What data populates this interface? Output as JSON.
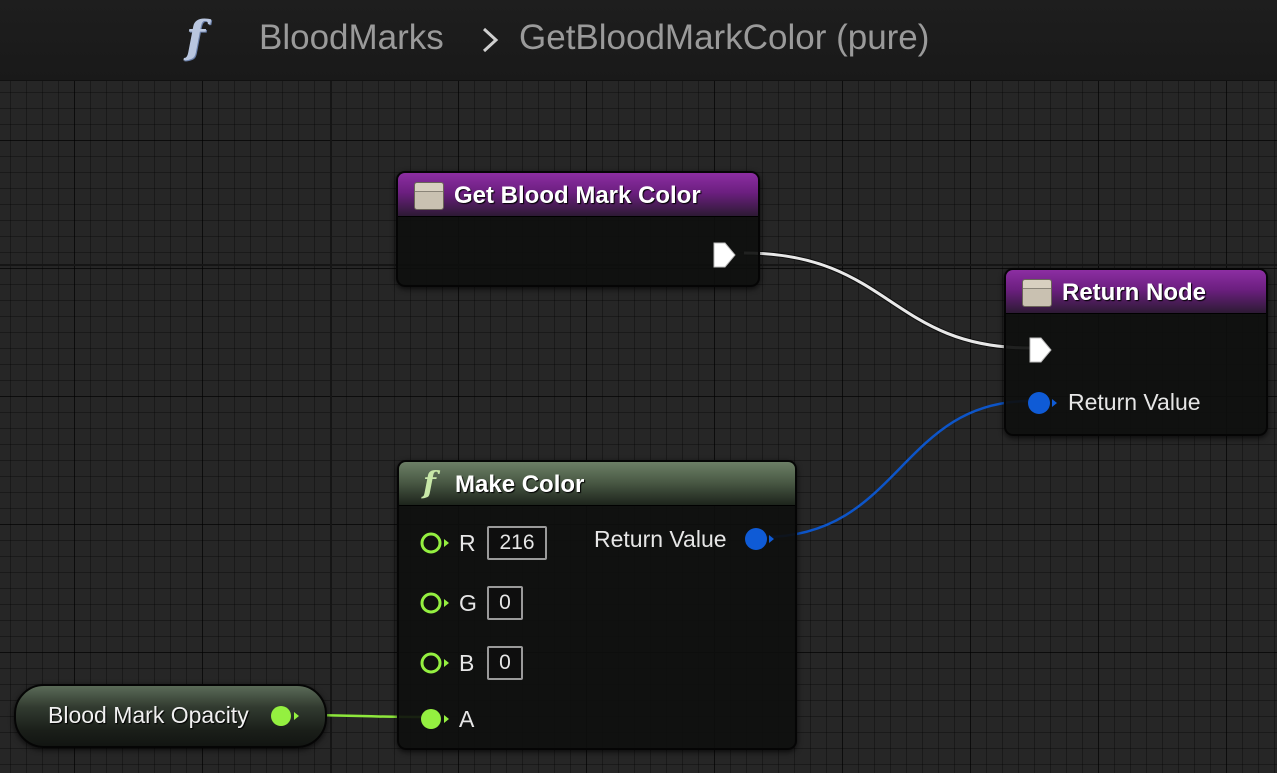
{
  "breadcrumb": {
    "icon": "function-icon",
    "blueprint": "BloodMarks",
    "separator_icon": "chevron-right-icon",
    "function": "GetBloodMarkColor (pure)"
  },
  "nodes": {
    "entry": {
      "title": "Get Blood Mark Color",
      "icon": "function-entry-icon",
      "header_color": "#7b2a90"
    },
    "return": {
      "title": "Return Node",
      "icon": "function-entry-icon",
      "header_color": "#7b2a90",
      "pins": {
        "return_value": "Return Value"
      }
    },
    "make_color": {
      "title": "Make Color",
      "icon": "function-icon",
      "header_color": "#56684f",
      "inputs": [
        {
          "label": "R",
          "value": "216"
        },
        {
          "label": "G",
          "value": "0"
        },
        {
          "label": "B",
          "value": "0"
        },
        {
          "label": "A",
          "value": ""
        }
      ],
      "output": "Return Value"
    },
    "variable": {
      "label": "Blood Mark Opacity"
    }
  },
  "colors": {
    "exec_pin": "#ffffff",
    "struct_pin": "#0f5bd6",
    "float_pin": "#94f040",
    "grid_background": "#262626"
  }
}
